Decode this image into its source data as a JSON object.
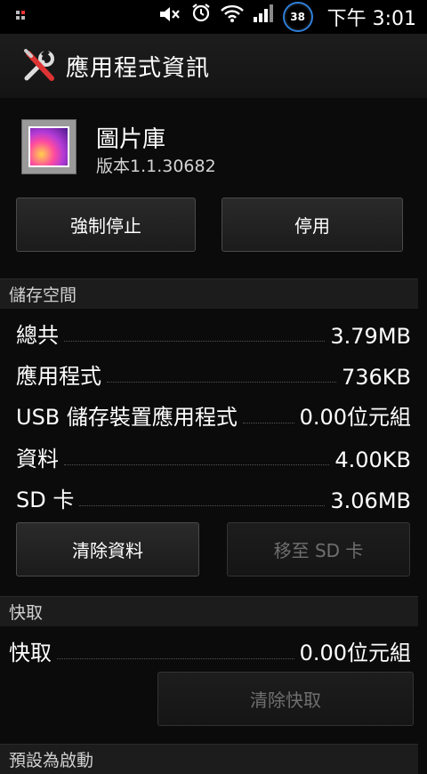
{
  "status_bar": {
    "icons": [
      "mute-icon",
      "alarm-icon",
      "wifi-icon",
      "signal-icon"
    ],
    "battery_level": "38",
    "time": "下午 3:01"
  },
  "title_bar": {
    "title": "應用程式資訊"
  },
  "app": {
    "name": "圖片庫",
    "version": "版本1.1.30682"
  },
  "actions": {
    "force_stop": "強制停止",
    "disable": "停用"
  },
  "storage": {
    "header": "儲存空間",
    "rows": [
      {
        "label": "總共",
        "value": "3.79MB"
      },
      {
        "label": "應用程式",
        "value": "736KB"
      },
      {
        "label": "USB 儲存裝置應用程式",
        "value": "0.00位元組"
      },
      {
        "label": "資料",
        "value": "4.00KB"
      },
      {
        "label": "SD 卡",
        "value": "3.06MB"
      }
    ],
    "clear_data": "清除資料",
    "move_to_sd": "移至 SD 卡"
  },
  "cache": {
    "header": "快取",
    "label": "快取",
    "value": "0.00位元組",
    "clear_cache": "清除快取"
  },
  "launch_default": {
    "header": "預設為啟動"
  }
}
